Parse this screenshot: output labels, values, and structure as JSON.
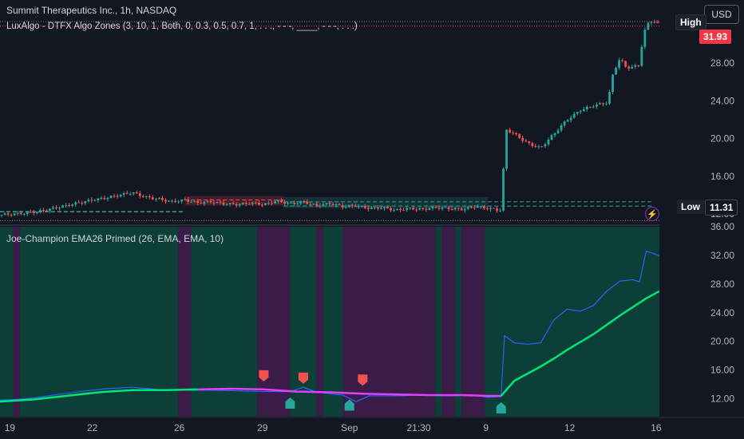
{
  "legend": {
    "symbol_line": "Summit Therapeutics Inc., 1h, NASDAQ",
    "indicator_line": "LuxAlgo - DTFX Algo Zones (3, 10, 1, Both, 0, 0.3, 0.5, 0.7, 1, . . ., - - -, ____, - - -, . . .)",
    "lower_indicator": "Joe-Champion EMA26 Primed (26, EMA, EMA, 10)"
  },
  "currency_button": "USD",
  "price_tags": {
    "high_label": "High",
    "low_label": "Low",
    "low_value": "11.31",
    "last_value": "31.93"
  },
  "colors": {
    "up": "#26a69a",
    "down": "#ef5350",
    "ema_fast": "#2962ff",
    "ema_slow": "#00e676",
    "bear_line": "#e040fb",
    "zone_bull": "#0b4e3f",
    "zone_bear": "#4a1f55"
  },
  "icons": {
    "alert": "lightning-icon"
  },
  "chart_data": [
    {
      "type": "candlestick",
      "title": "Summit Therapeutics Inc., 1h, NASDAQ",
      "x_ticks": [
        "19",
        "22",
        "26",
        "29",
        "Sep",
        "21:30",
        "9",
        "12",
        "16"
      ],
      "y_ticks": [
        12,
        16,
        20,
        24,
        28
      ],
      "ylim": [
        11,
        33
      ],
      "high_marker": "High",
      "low": 11.31,
      "last": 31.93,
      "close_path": [
        [
          0,
          11.9
        ],
        [
          0.02,
          12.0
        ],
        [
          0.04,
          12.1
        ],
        [
          0.06,
          12.3
        ],
        [
          0.08,
          12.6
        ],
        [
          0.1,
          12.9
        ],
        [
          0.12,
          13.2
        ],
        [
          0.14,
          13.5
        ],
        [
          0.16,
          13.7
        ],
        [
          0.18,
          14.0
        ],
        [
          0.2,
          14.3
        ],
        [
          0.22,
          13.8
        ],
        [
          0.24,
          13.6
        ],
        [
          0.26,
          13.3
        ],
        [
          0.28,
          13.5
        ],
        [
          0.3,
          13.2
        ],
        [
          0.32,
          13.3
        ],
        [
          0.34,
          13.1
        ],
        [
          0.36,
          13.0
        ],
        [
          0.38,
          13.2
        ],
        [
          0.4,
          13.0
        ],
        [
          0.42,
          13.4
        ],
        [
          0.44,
          13.1
        ],
        [
          0.46,
          13.3
        ],
        [
          0.48,
          12.9
        ],
        [
          0.5,
          13.1
        ],
        [
          0.52,
          12.8
        ],
        [
          0.54,
          12.9
        ],
        [
          0.56,
          12.6
        ],
        [
          0.58,
          12.7
        ],
        [
          0.6,
          12.4
        ],
        [
          0.62,
          12.6
        ],
        [
          0.64,
          12.5
        ],
        [
          0.66,
          12.7
        ],
        [
          0.68,
          12.6
        ],
        [
          0.7,
          12.5
        ],
        [
          0.72,
          12.8
        ],
        [
          0.74,
          12.6
        ],
        [
          0.76,
          12.4
        ],
        [
          0.763,
          16.0
        ],
        [
          0.766,
          21.0
        ],
        [
          0.78,
          20.5
        ],
        [
          0.8,
          19.5
        ],
        [
          0.82,
          19.0
        ],
        [
          0.84,
          20.5
        ],
        [
          0.86,
          22.0
        ],
        [
          0.88,
          23.0
        ],
        [
          0.9,
          23.5
        ],
        [
          0.92,
          23.8
        ],
        [
          0.925,
          25.0
        ],
        [
          0.93,
          27.0
        ],
        [
          0.94,
          28.5
        ],
        [
          0.95,
          27.5
        ],
        [
          0.96,
          27.6
        ],
        [
          0.97,
          27.8
        ],
        [
          0.975,
          31.0
        ],
        [
          0.985,
          32.5
        ],
        [
          0.995,
          32.4
        ],
        [
          1.0,
          31.93
        ]
      ]
    },
    {
      "type": "line",
      "title": "Joe-Champion EMA26 Primed (26, EMA, EMA, 10)",
      "x_ticks": [
        "19",
        "22",
        "26",
        "29",
        "Sep",
        "21:30",
        "9",
        "12",
        "16"
      ],
      "y_ticks": [
        12,
        16,
        20,
        24,
        28,
        32,
        36
      ],
      "ylim": [
        9.5,
        36
      ],
      "series": [
        {
          "values": [
            [
              0,
              11.8
            ],
            [
              0.04,
              12.0
            ],
            [
              0.08,
              12.5
            ],
            [
              0.12,
              13.0
            ],
            [
              0.16,
              13.4
            ],
            [
              0.2,
              13.6
            ],
            [
              0.24,
              13.3
            ],
            [
              0.28,
              13.2
            ],
            [
              0.32,
              13.2
            ],
            [
              0.36,
              13.1
            ],
            [
              0.4,
              13.0
            ],
            [
              0.44,
              13.0
            ],
            [
              0.46,
              13.6
            ],
            [
              0.48,
              12.9
            ],
            [
              0.52,
              12.5
            ],
            [
              0.54,
              11.6
            ],
            [
              0.56,
              12.4
            ],
            [
              0.6,
              12.4
            ],
            [
              0.64,
              12.5
            ],
            [
              0.68,
              12.4
            ],
            [
              0.72,
              12.5
            ],
            [
              0.74,
              12.2
            ],
            [
              0.76,
              12.3
            ],
            [
              0.765,
              20.8
            ],
            [
              0.78,
              19.8
            ],
            [
              0.8,
              19.6
            ],
            [
              0.82,
              19.8
            ],
            [
              0.84,
              23.0
            ],
            [
              0.86,
              24.5
            ],
            [
              0.88,
              24.2
            ],
            [
              0.9,
              25.0
            ],
            [
              0.92,
              27.0
            ],
            [
              0.94,
              28.4
            ],
            [
              0.96,
              28.6
            ],
            [
              0.97,
              28.3
            ],
            [
              0.98,
              32.6
            ],
            [
              0.99,
              32.3
            ],
            [
              1.0,
              31.9
            ]
          ]
        },
        {
          "values": [
            [
              0,
              11.6
            ],
            [
              0.05,
              11.9
            ],
            [
              0.1,
              12.4
            ],
            [
              0.15,
              12.9
            ],
            [
              0.2,
              13.2
            ],
            [
              0.25,
              13.2
            ],
            [
              0.3,
              13.3
            ],
            [
              0.35,
              13.4
            ],
            [
              0.4,
              13.3
            ],
            [
              0.45,
              13.0
            ],
            [
              0.5,
              12.9
            ],
            [
              0.55,
              12.7
            ],
            [
              0.6,
              12.6
            ],
            [
              0.65,
              12.5
            ],
            [
              0.7,
              12.5
            ],
            [
              0.74,
              12.4
            ],
            [
              0.76,
              12.4
            ],
            [
              0.78,
              14.5
            ],
            [
              0.8,
              15.5
            ],
            [
              0.82,
              16.5
            ],
            [
              0.84,
              17.6
            ],
            [
              0.86,
              18.8
            ],
            [
              0.88,
              19.9
            ],
            [
              0.9,
              21.0
            ],
            [
              0.92,
              22.3
            ],
            [
              0.94,
              23.6
            ],
            [
              0.96,
              24.8
            ],
            [
              0.98,
              26.0
            ],
            [
              1.0,
              27.0
            ]
          ]
        }
      ],
      "bull_signals": [
        0.44,
        0.53,
        0.76
      ],
      "bear_signals": [
        0.4,
        0.46,
        0.55
      ]
    }
  ]
}
